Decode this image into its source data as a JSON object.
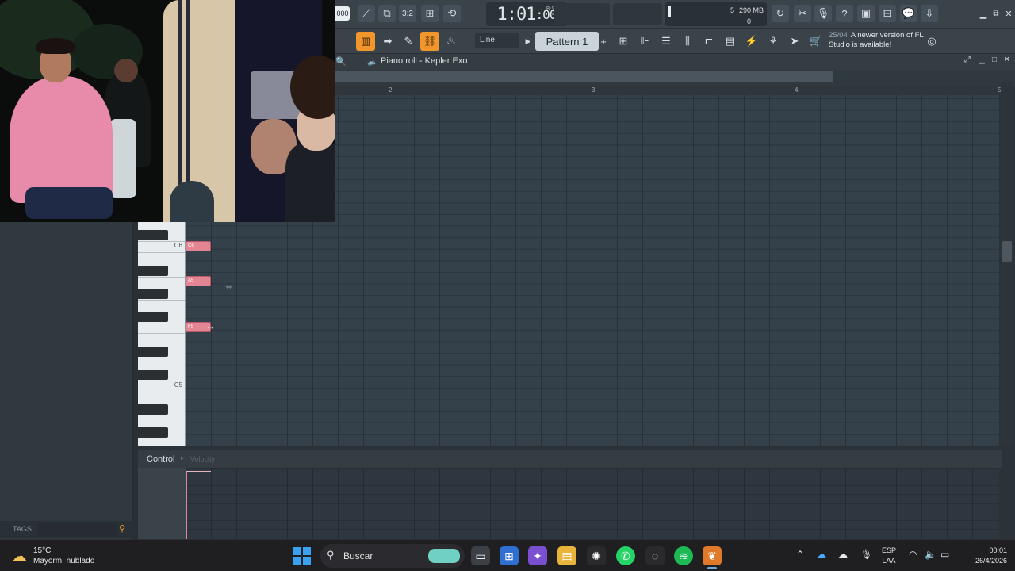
{
  "toolbar": {
    "time": "1:01",
    "time_sub": ":00",
    "time_sig": "B:S:T",
    "tempo_chip": "000",
    "memory": "290 MB",
    "cpu_val": "5",
    "voices": "0",
    "snap": "Line",
    "pattern": "Pattern 1",
    "news_date": "25/04",
    "news_text": "A newer version of FL Studio is available!"
  },
  "piano_roll": {
    "title": "Piano roll - Kepler Exo",
    "ruler": [
      "2",
      "3",
      "4",
      "5"
    ],
    "key_labels": {
      "c6": "C6",
      "c5": "C5"
    },
    "notes": [
      {
        "label": "C6",
        "pitch": "C6"
      },
      {
        "label": "A5",
        "pitch": "A5"
      },
      {
        "label": "F5",
        "pitch": "F5"
      }
    ],
    "control_label": "Control",
    "control_sub": "Velocity"
  },
  "browser": {
    "tags_label": "TAGS"
  },
  "taskbar": {
    "weather_temp": "15°C",
    "weather_cond": "Mayorm. nublado",
    "search": "Buscar",
    "lang_top": "ESP",
    "lang_bottom": "LAA",
    "time": "00:01",
    "date": "26/4/2026"
  },
  "colors": {
    "accent": "#f0962d",
    "note": "#e48593",
    "grid": "#34404a"
  }
}
